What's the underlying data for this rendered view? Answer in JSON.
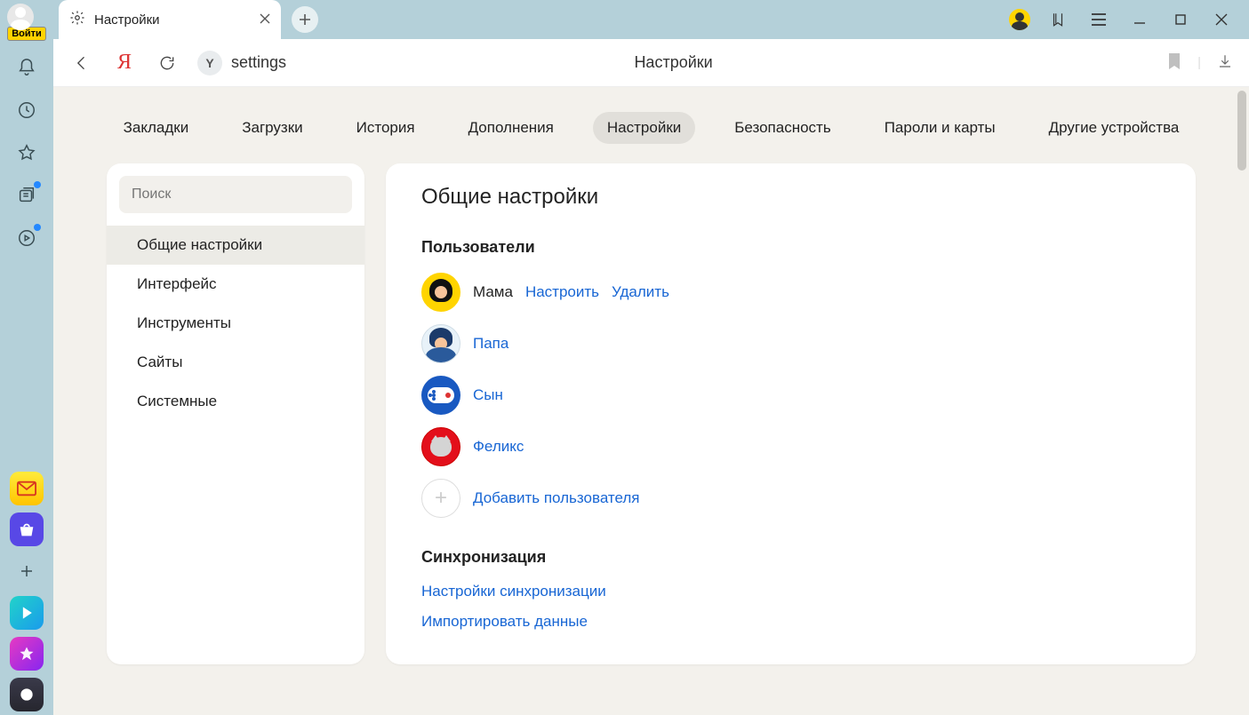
{
  "leftbar": {
    "login_label": "Войти"
  },
  "tab": {
    "title": "Настройки"
  },
  "address_bar": {
    "url_text": "settings",
    "page_title": "Настройки",
    "url_chip": "Y"
  },
  "top_nav": {
    "items": [
      {
        "label": "Закладки"
      },
      {
        "label": "Загрузки"
      },
      {
        "label": "История"
      },
      {
        "label": "Дополнения"
      },
      {
        "label": "Настройки",
        "active": true
      },
      {
        "label": "Безопасность"
      },
      {
        "label": "Пароли и карты"
      },
      {
        "label": "Другие устройства"
      }
    ]
  },
  "side_panel": {
    "search_placeholder": "Поиск",
    "items": [
      {
        "label": "Общие настройки",
        "active": true
      },
      {
        "label": "Интерфейс"
      },
      {
        "label": "Инструменты"
      },
      {
        "label": "Сайты"
      },
      {
        "label": "Системные"
      }
    ]
  },
  "main_panel": {
    "heading": "Общие настройки",
    "users_title": "Пользователи",
    "users": [
      {
        "name": "Мама",
        "current": true,
        "configure": "Настроить",
        "delete": "Удалить"
      },
      {
        "name": "Папа"
      },
      {
        "name": "Сын"
      },
      {
        "name": "Феликс"
      }
    ],
    "add_user_label": "Добавить пользователя",
    "sync_title": "Синхронизация",
    "sync_settings_link": "Настройки синхронизации",
    "import_link": "Импортировать данные"
  }
}
